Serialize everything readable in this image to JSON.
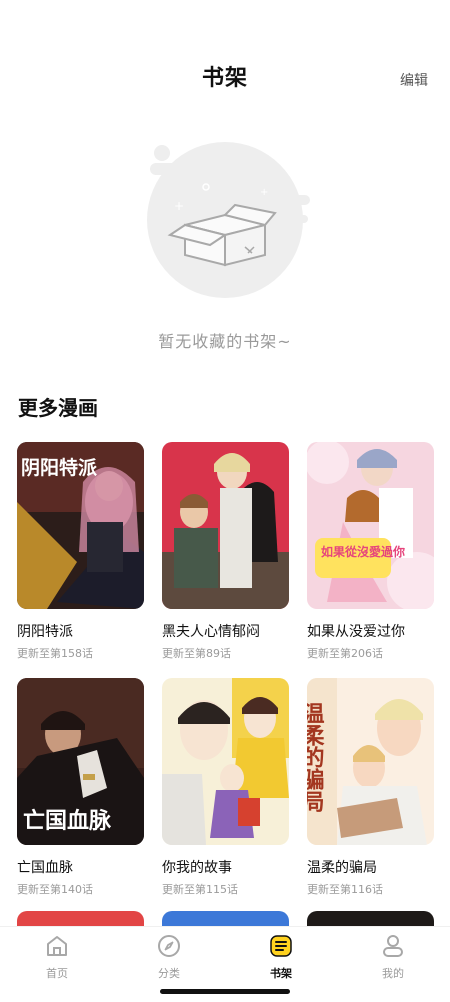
{
  "header": {
    "title": "书架",
    "edit_label": "编辑"
  },
  "empty_state": {
    "message": "暂无收藏的书架~"
  },
  "section": {
    "title": "更多漫画"
  },
  "comics": [
    {
      "title": "阴阳特派",
      "update": "更新至第158话",
      "cover_text": "阴阳特派"
    },
    {
      "title": "黑夫人心情郁闷",
      "update": "更新至第89话",
      "cover_text": ""
    },
    {
      "title": "如果从没爱过你",
      "update": "更新至第206话",
      "cover_text": "如果從沒愛過你"
    },
    {
      "title": "亡国血脉",
      "update": "更新至第140话",
      "cover_text": "亡国血脉"
    },
    {
      "title": "你我的故事",
      "update": "更新至第115话",
      "cover_text": ""
    },
    {
      "title": "温柔的骗局",
      "update": "更新至第116话",
      "cover_text": "温柔的骗局"
    }
  ],
  "tabs": [
    {
      "label": "首页",
      "icon": "home-icon",
      "active": false
    },
    {
      "label": "分类",
      "icon": "compass-icon",
      "active": false
    },
    {
      "label": "书架",
      "icon": "bookshelf-icon",
      "active": true
    },
    {
      "label": "我的",
      "icon": "profile-icon",
      "active": false
    }
  ],
  "colors": {
    "accent": "#FFD21F",
    "muted": "#9a9a9a",
    "text": "#111111"
  }
}
